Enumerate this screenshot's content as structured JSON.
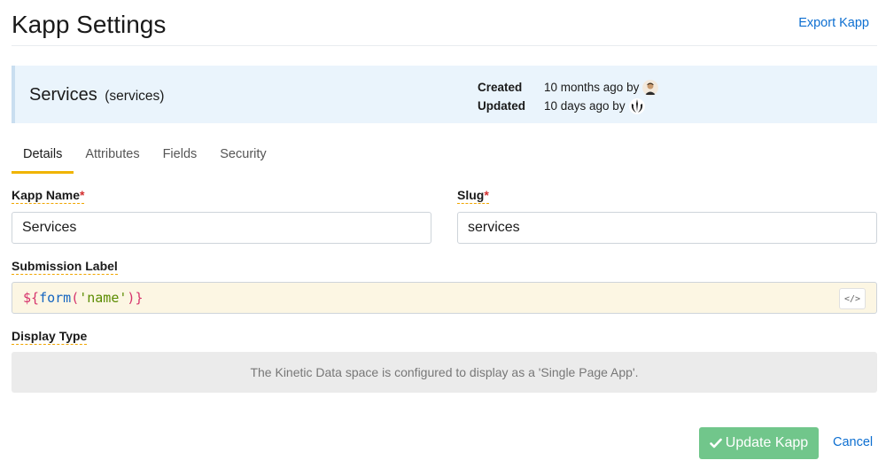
{
  "header": {
    "title": "Kapp Settings",
    "export_label": "Export Kapp"
  },
  "info": {
    "name": "Services",
    "slug_display": "(services)",
    "created_label": "Created",
    "created_value": "10 months ago by",
    "updated_label": "Updated",
    "updated_value": "10 days ago by"
  },
  "tabs": [
    {
      "label": "Details",
      "active": true
    },
    {
      "label": "Attributes",
      "active": false
    },
    {
      "label": "Fields",
      "active": false
    },
    {
      "label": "Security",
      "active": false
    }
  ],
  "form": {
    "kapp_name_label": "Kapp Name",
    "kapp_name_value": "Services",
    "slug_label": "Slug",
    "slug_value": "services",
    "required_mark": "*",
    "submission_label_label": "Submission Label",
    "submission_code": {
      "prefix": "${",
      "func": "form",
      "open": "(",
      "arg": "'name'",
      "close": ")",
      "suffix": "}"
    },
    "code_toggle_icon": "</>",
    "display_type_label": "Display Type",
    "display_type_message": "The Kinetic Data space is configured to display as a 'Single Page App'."
  },
  "actions": {
    "update_label": "Update Kapp",
    "cancel_label": "Cancel"
  },
  "colors": {
    "accent": "#f0b400",
    "link": "#0d6fd1",
    "update_button": "#71c68b",
    "info_bar": "#eaf4fc"
  }
}
